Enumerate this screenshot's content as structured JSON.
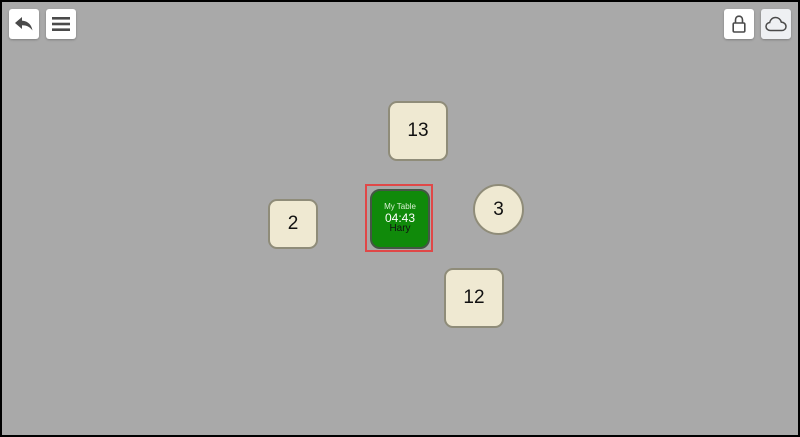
{
  "toolbar": {
    "left": [
      {
        "icon": "undo-arrow-icon"
      },
      {
        "icon": "hamburger-menu-icon"
      }
    ],
    "right": [
      {
        "icon": "lock-icon"
      },
      {
        "icon": "cloud-icon",
        "active": true
      }
    ]
  },
  "tables": {
    "t13": {
      "number": "13",
      "shape": "square"
    },
    "t2": {
      "number": "2",
      "shape": "square"
    },
    "t3": {
      "number": "3",
      "shape": "round"
    },
    "t12": {
      "number": "12",
      "shape": "square"
    }
  },
  "my_table": {
    "label": "My Table",
    "time": "04:43",
    "user": "Hary",
    "selected": true
  },
  "colors": {
    "canvas": "#a9a9a9",
    "table_fill": "#efe9d2",
    "table_border": "#8f8c79",
    "my_table_fill": "#108a0a",
    "selection": "#e04848"
  }
}
